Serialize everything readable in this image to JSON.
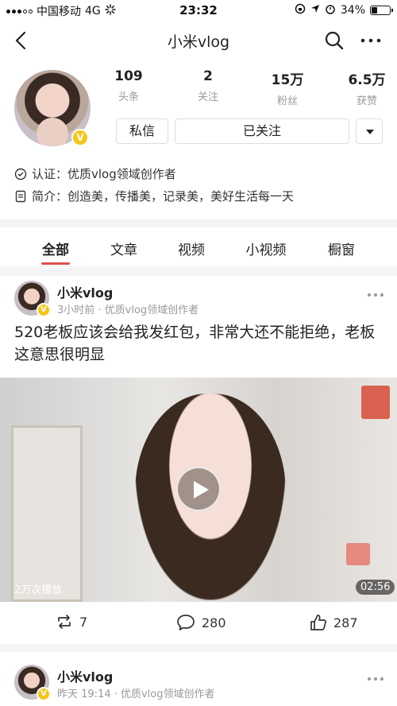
{
  "status_bar": {
    "carrier": "中国移动",
    "network": "4G",
    "time": "23:32",
    "battery": "34%",
    "battery_level": 0.34
  },
  "navbar": {
    "title": "小米vlog",
    "back_icon": "chevron-left-icon",
    "search_icon": "search-icon",
    "more_icon": "more-dots-icon"
  },
  "profile": {
    "stats": [
      {
        "value": "109",
        "label": "头条"
      },
      {
        "value": "2",
        "label": "关注"
      },
      {
        "value": "15万",
        "label": "粉丝"
      },
      {
        "value": "6.5万",
        "label": "获赞"
      }
    ],
    "message_button": "私信",
    "follow_button": "已关注",
    "verify_label": "认证：优质vlog领域创作者",
    "intro_label": "简介：创造美，传播美，记录美，美好生活每一天",
    "badge": "V"
  },
  "tabs": [
    {
      "label": "全部",
      "active": true
    },
    {
      "label": "文章",
      "active": false
    },
    {
      "label": "视频",
      "active": false
    },
    {
      "label": "小视频",
      "active": false
    },
    {
      "label": "橱窗",
      "active": false
    }
  ],
  "posts": [
    {
      "author": "小米vlog",
      "meta": "3小时前 · 优质vlog领域创作者",
      "text": "520老板应该会给我发红包，非常大还不能拒绝，老板这意思很明显",
      "video": {
        "views": "2万次播放",
        "duration": "02:56"
      },
      "actions": {
        "repost": "7",
        "comments": "280",
        "likes": "287"
      }
    },
    {
      "author": "小米vlog",
      "meta": "昨天 19:14 · 优质vlog领域创作者"
    }
  ],
  "colors": {
    "accent": "#e2504e",
    "badge": "#f5c518"
  }
}
